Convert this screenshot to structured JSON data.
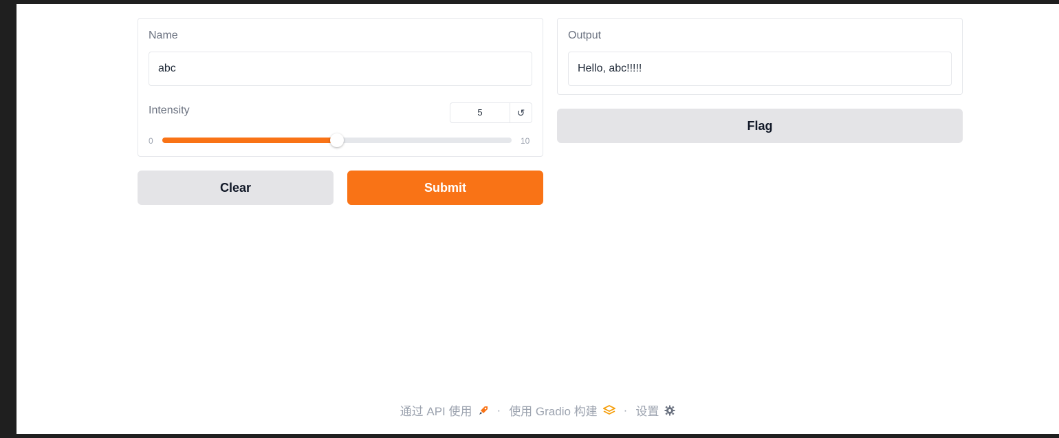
{
  "inputs": {
    "name": {
      "label": "Name",
      "value": "abc"
    },
    "intensity": {
      "label": "Intensity",
      "value": "5",
      "min": "0",
      "max": "10",
      "fraction": 0.5,
      "reset_icon": "↺"
    }
  },
  "buttons": {
    "clear": "Clear",
    "submit": "Submit",
    "flag": "Flag"
  },
  "output": {
    "label": "Output",
    "value": "Hello, abc!!!!!"
  },
  "footer": {
    "api_link": "通过 API 使用",
    "separator": "·",
    "built_with": "使用 Gradio 构建",
    "settings": "设置"
  },
  "colors": {
    "accent": "#f97316",
    "secondary": "#e4e4e7"
  }
}
